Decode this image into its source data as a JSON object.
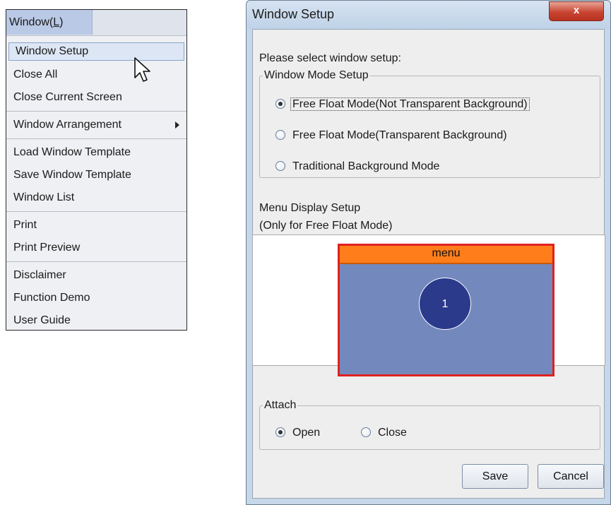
{
  "menu": {
    "title_prefix": "Window(",
    "title_mnemonic": "L",
    "title_suffix": ")",
    "items": {
      "window_setup": "Window Setup",
      "close_all": "Close All",
      "close_current_screen": "Close Current Screen",
      "window_arrangement": "Window Arrangement",
      "load_window_template": "Load Window Template",
      "save_window_template": "Save Window Template",
      "window_list": "Window List",
      "print": "Print",
      "print_preview": "Print Preview",
      "disclaimer": "Disclaimer",
      "function_demo": "Function Demo",
      "user_guide": "User Guide"
    }
  },
  "dialog": {
    "title": "Window Setup",
    "close_label": "x",
    "prompt": "Please select window setup:",
    "mode_group": {
      "legend": "Window Mode Setup",
      "options": [
        "Free Float Mode(Not Transparent Background)",
        "Free Float Mode(Transparent Background)",
        "Traditional Background Mode"
      ],
      "selected_index": 0
    },
    "menu_display": {
      "label_line1": "Menu Display Setup",
      "label_line2": "(Only for Free Float Mode)",
      "preview_menu_label": "menu",
      "preview_circle_label": "1"
    },
    "attach_group": {
      "legend": "Attach",
      "open_label": "Open",
      "close_label": "Close",
      "selected": "Open"
    },
    "buttons": {
      "save": "Save",
      "cancel": "Cancel"
    }
  },
  "colors": {
    "preview_menu_bar": "#ff7d1a",
    "preview_frame_border": "#e02020",
    "preview_background": "#7389bd",
    "preview_circle": "#2c3a8c",
    "close_button": "#c84532"
  }
}
